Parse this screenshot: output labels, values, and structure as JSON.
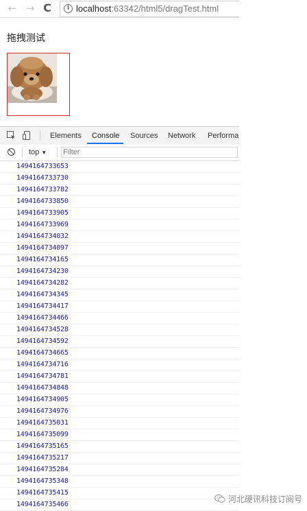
{
  "browser": {
    "url_host": "localhost",
    "url_rest": ":63342/html5/dragTest.html",
    "back_icon": "arrow-left-icon",
    "forward_icon": "arrow-right-icon",
    "reload_icon": "reload-icon",
    "info_icon": "info-icon"
  },
  "page": {
    "heading": "拖拽测试",
    "drag_border_color": "#d42b2b"
  },
  "devtools": {
    "tabs": [
      "Elements",
      "Console",
      "Sources",
      "Network",
      "Performar"
    ],
    "active_tab": "Console",
    "context": "top",
    "filter_placeholder": "Filter",
    "accent_color": "#1a73e8",
    "log_color": "#1a1aa6",
    "logs": [
      "1494164733653",
      "1494164733730",
      "1494164733782",
      "1494164733850",
      "1494164733905",
      "1494164733969",
      "1494164734032",
      "1494164734097",
      "1494164734165",
      "1494164734230",
      "1494164734282",
      "1494164734345",
      "1494164734417",
      "1494164734466",
      "1494164734528",
      "1494164734592",
      "1494164734665",
      "1494164734716",
      "1494164734781",
      "1494164734848",
      "1494164734905",
      "1494164734976",
      "1494164735031",
      "1494164735099",
      "1494164735165",
      "1494164735217",
      "1494164735284",
      "1494164735348",
      "1494164735415",
      "1494164735466"
    ]
  },
  "watermark": {
    "text": "河北硬讯科技订阅号",
    "icon": "wechat-icon"
  }
}
